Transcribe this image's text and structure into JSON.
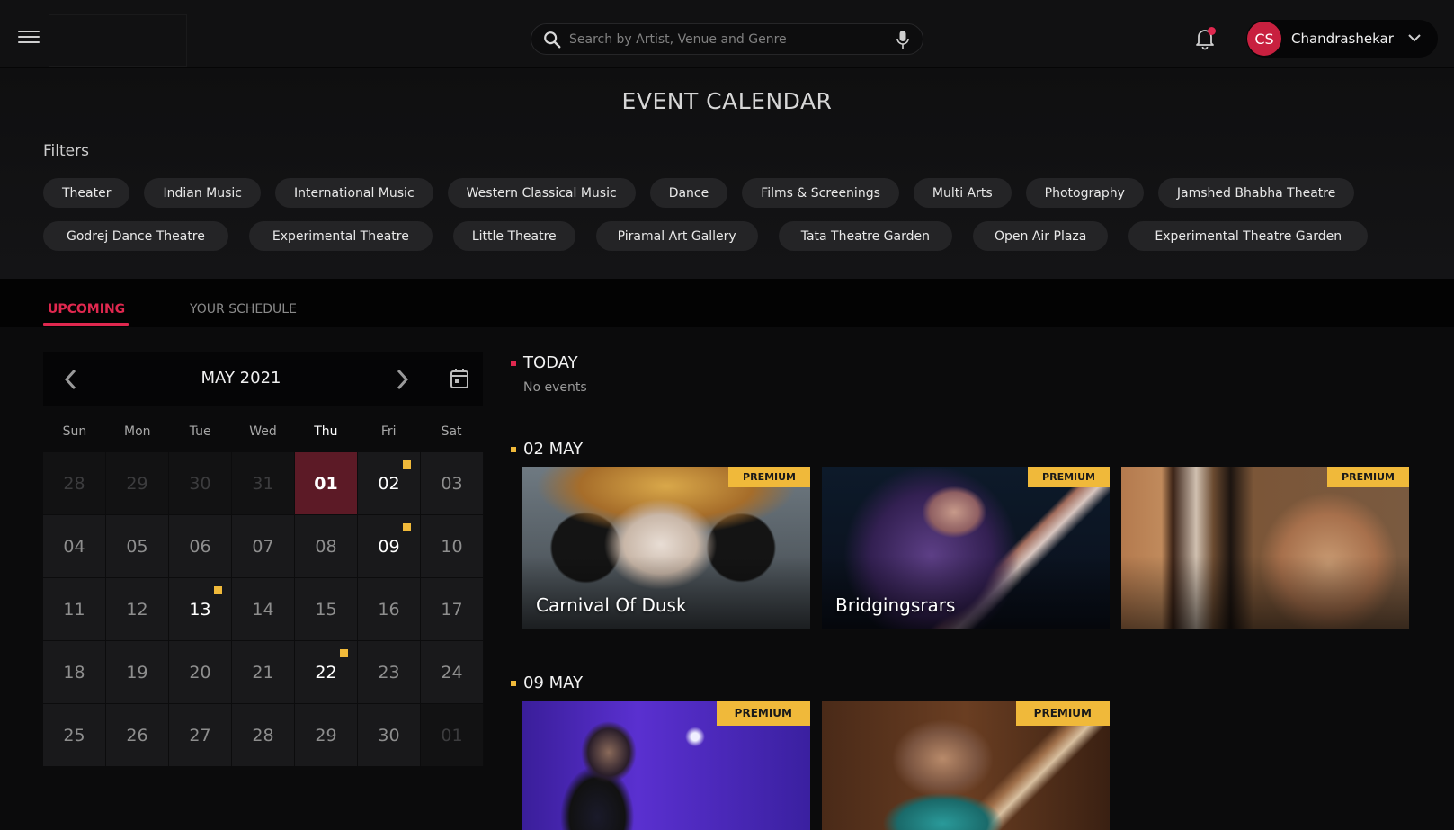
{
  "header": {
    "search_placeholder": "Search by Artist, Venue and Genre",
    "user_initials": "CS",
    "user_name": "Chandrashekar",
    "notification_dot": true
  },
  "page": {
    "title": "EVENT CALENDAR",
    "filters_label": "Filters"
  },
  "filters": {
    "row1": [
      "Theater",
      "Indian Music",
      "International Music",
      "Western Classical Music",
      "Dance",
      "Films & Screenings",
      "Multi Arts",
      "Photography",
      "Jamshed Bhabha Theatre"
    ],
    "row2": [
      "Godrej Dance Theatre",
      "Experimental Theatre",
      "Little Theatre",
      "Piramal Art Gallery",
      "Tata Theatre Garden",
      "Open Air Plaza",
      "Experimental Theatre Garden"
    ]
  },
  "tabs": [
    {
      "label": "UPCOMING",
      "active": true
    },
    {
      "label": "YOUR SCHEDULE",
      "active": false
    }
  ],
  "calendar": {
    "month_label": "MAY 2021",
    "weekdays": [
      "Sun",
      "Mon",
      "Tue",
      "Wed",
      "Thu",
      "Fri",
      "Sat"
    ],
    "today_weekday_index": 4,
    "days": [
      {
        "d": "28",
        "other": true
      },
      {
        "d": "29",
        "other": true
      },
      {
        "d": "30",
        "other": true
      },
      {
        "d": "31",
        "other": true
      },
      {
        "d": "01",
        "selected": true
      },
      {
        "d": "02",
        "event": true
      },
      {
        "d": "03"
      },
      {
        "d": "04"
      },
      {
        "d": "05"
      },
      {
        "d": "06"
      },
      {
        "d": "07"
      },
      {
        "d": "08"
      },
      {
        "d": "09",
        "event": true
      },
      {
        "d": "10"
      },
      {
        "d": "11"
      },
      {
        "d": "12"
      },
      {
        "d": "13",
        "event": true
      },
      {
        "d": "14"
      },
      {
        "d": "15"
      },
      {
        "d": "16"
      },
      {
        "d": "17"
      },
      {
        "d": "18"
      },
      {
        "d": "19"
      },
      {
        "d": "20"
      },
      {
        "d": "21"
      },
      {
        "d": "22",
        "event": true
      },
      {
        "d": "23"
      },
      {
        "d": "24"
      },
      {
        "d": "25"
      },
      {
        "d": "26"
      },
      {
        "d": "27"
      },
      {
        "d": "28"
      },
      {
        "d": "29"
      },
      {
        "d": "30"
      },
      {
        "d": "01",
        "other": true
      }
    ]
  },
  "events": {
    "today": {
      "label": "TODAY",
      "empty_text": "No events",
      "color": "#e0284f"
    },
    "groups": [
      {
        "label": "02 MAY",
        "color": "#f0b93a",
        "cards": [
          {
            "title": "Carnival Of Dusk",
            "badge": "PREMIUM"
          },
          {
            "title": "Bridgingsrars",
            "badge": "PREMIUM"
          },
          {
            "title": "",
            "badge": "PREMIUM"
          }
        ]
      },
      {
        "label": "09 MAY",
        "color": "#f0b93a",
        "cards": [
          {
            "title": "",
            "badge": "PREMIUM"
          },
          {
            "title": "",
            "badge": "PREMIUM"
          }
        ]
      }
    ]
  },
  "colors": {
    "accent": "#e0284f",
    "event_marker": "#f0b93a",
    "selected_day": "#5c1a26"
  }
}
